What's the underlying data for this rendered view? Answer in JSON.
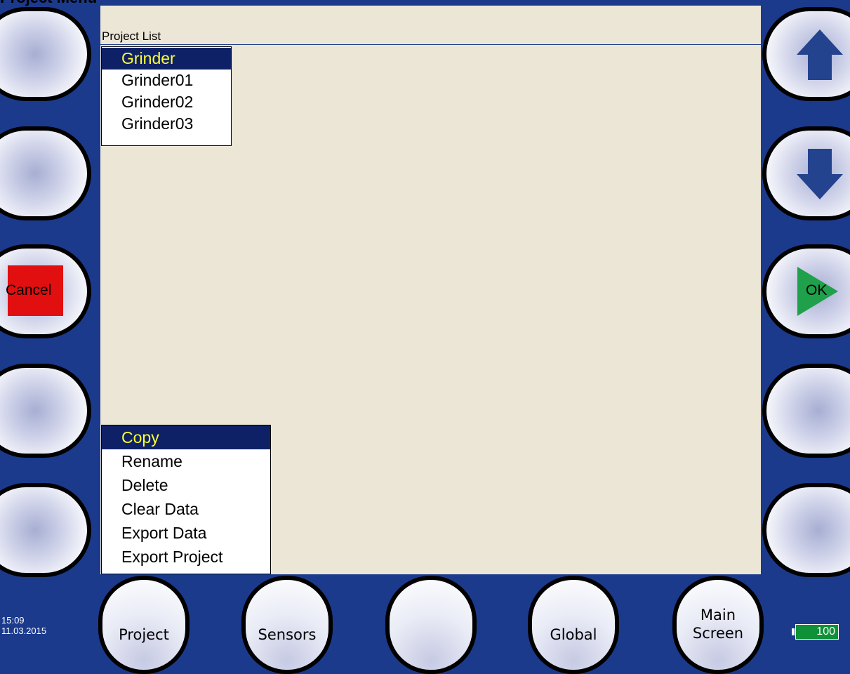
{
  "app": {
    "title": "Project Menu"
  },
  "project_list": {
    "caption": "Project List",
    "items": [
      "Grinder",
      "Grinder01",
      "Grinder02",
      "Grinder03"
    ],
    "selected": "Grinder"
  },
  "action_menu": {
    "items": [
      "Copy",
      "Rename",
      "Delete",
      "Clear Data",
      "Export Data",
      "Export Project"
    ],
    "selected": "Copy"
  },
  "side_buttons": {
    "cancel_label": "Cancel",
    "ok_label": "OK",
    "up_icon": "arrow-up-icon",
    "down_icon": "arrow-down-icon",
    "cancel_color": "#e10f0f",
    "ok_color": "#1fa04a"
  },
  "bottom_buttons": {
    "project": "Project",
    "sensors": "Sensors",
    "empty": "",
    "global": "Global",
    "main_screen_line1": "Main",
    "main_screen_line2": "Screen"
  },
  "status": {
    "time": "15:09",
    "date": "11.03.2015",
    "battery": "100"
  },
  "colors": {
    "frame": "#1b3a8c",
    "screen": "#ebe6d6",
    "selection_bg": "#0e2166",
    "selection_text": "#ffff33"
  }
}
